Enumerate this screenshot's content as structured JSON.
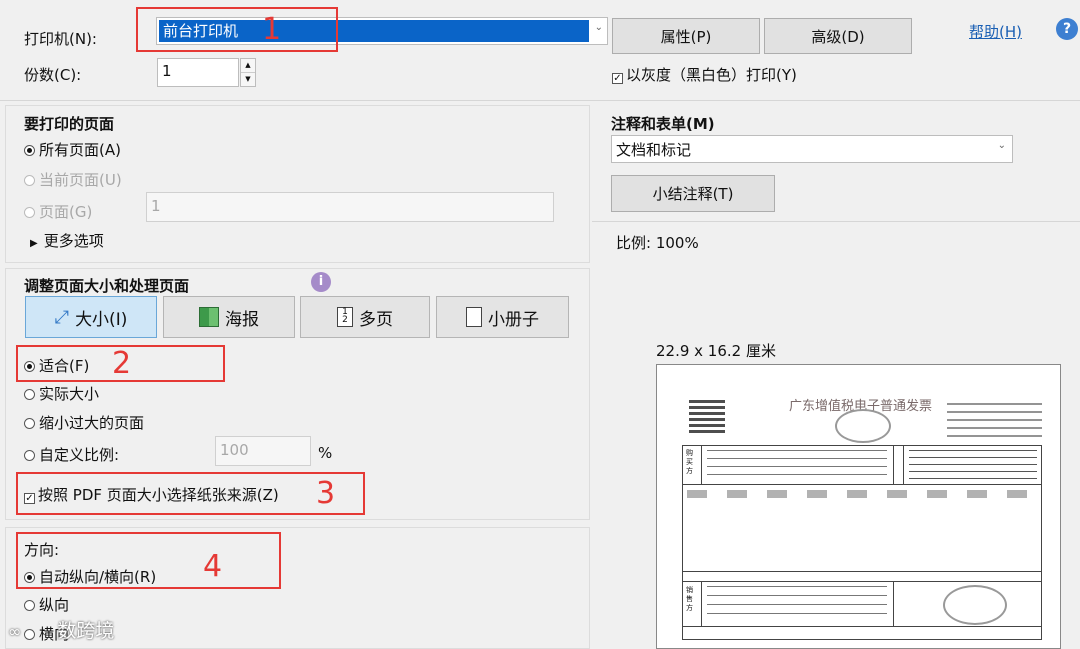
{
  "printer": {
    "label": "打印机(N):",
    "value": "前台打印机",
    "properties_button": "属性(P)",
    "advanced_button": "高级(D)",
    "help_link": "帮助(H)",
    "help_icon": "question-circle-icon"
  },
  "copies": {
    "label": "份数(C):",
    "value": "1"
  },
  "grayscale": {
    "label": "以灰度（黑白色）打印(Y)",
    "checked": true
  },
  "pages_to_print": {
    "title": "要打印的页面",
    "all": "所有页面(A)",
    "current": "当前页面(U)",
    "pages": "页面(G)",
    "pages_value": "1",
    "more_options": "更多选项"
  },
  "comments_forms": {
    "title": "注释和表单(M)",
    "selected": "文档和标记",
    "summarize_button": "小结注释(T)"
  },
  "scale": {
    "label": "比例:",
    "value": "100%"
  },
  "page_sizing": {
    "title": "调整页面大小和处理页面",
    "info_icon": "info-icon",
    "tabs": [
      "大小(I)",
      "海报",
      "多页",
      "小册子"
    ],
    "fit": "适合(F)",
    "actual_size": "实际大小",
    "shrink": "缩小过大的页面",
    "custom_scale": "自定义比例:",
    "custom_value": "100",
    "percent": "%",
    "paper_source": "按照 PDF 页面大小选择纸张来源(Z)"
  },
  "orientation": {
    "title": "方向:",
    "auto": "自动纵向/横向(R)",
    "portrait": "纵向",
    "landscape": "横向"
  },
  "preview": {
    "size_label": "22.9 x 16.2 厘米",
    "invoice_title": "广东增值税电子普通发票",
    "seller_label": "销售方",
    "buyer_label": "购买方"
  },
  "annotations": [
    "1",
    "2",
    "3",
    "4"
  ],
  "watermark": "数跨境",
  "colors": {
    "annotation_red": "#e53935",
    "selection_blue": "#0a64c8"
  }
}
